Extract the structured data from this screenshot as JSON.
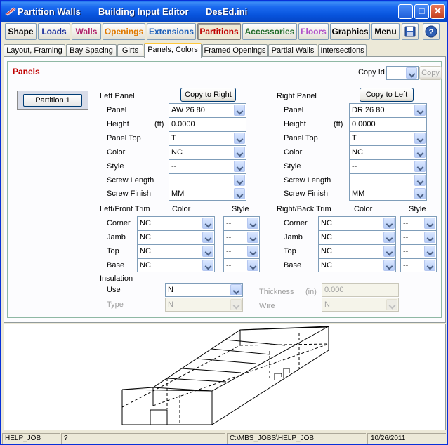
{
  "window": {
    "title_app": "Partition Walls",
    "title_module": "Building Input Editor",
    "title_file": "DesEd.ini",
    "minimize": "_",
    "maximize": "□",
    "close": "✕"
  },
  "toolbar": {
    "buttons": [
      {
        "label": "Shape",
        "color": "#000000"
      },
      {
        "label": "Loads",
        "color": "#1A2E9C"
      },
      {
        "label": "Walls",
        "color": "#B0206A"
      },
      {
        "label": "Openings",
        "color": "#E07A00"
      },
      {
        "label": "Extensions",
        "color": "#1D5FB8"
      },
      {
        "label": "Partitions",
        "color": "#C00000"
      },
      {
        "label": "Accessories",
        "color": "#1E6A28"
      },
      {
        "label": "Floors",
        "color": "#B050C8"
      },
      {
        "label": "Graphics",
        "color": "#000000"
      },
      {
        "label": "Menu",
        "color": "#000000"
      }
    ],
    "icons": [
      "save-icon",
      "help-icon"
    ]
  },
  "subtabs": [
    "Layout, Framing",
    "Bay Spacing",
    "Girts",
    "Panels, Colors",
    "Framed Openings",
    "Partial Walls",
    "Intersections"
  ],
  "panels": {
    "title": "Panels",
    "copy_id_label": "Copy Id",
    "copy_id_value": "",
    "copy_button": "Copy",
    "partition_button": "Partition 1",
    "left": {
      "header": "Left Panel",
      "copy_button": "Copy to Right",
      "panel_label": "Panel",
      "panel_value": "AW 26 80",
      "height_label": "Height",
      "height_unit": "(ft)",
      "height_value": "0.0000",
      "top_label": "Panel Top",
      "top_value": "T",
      "color_label": "Color",
      "color_value": "NC",
      "style_label": "Style",
      "style_value": "--",
      "screw_length_label": "Screw Length",
      "screw_length_value": "",
      "screw_finish_label": "Screw Finish",
      "screw_finish_value": "MM"
    },
    "right": {
      "header": "Right Panel",
      "copy_button": "Copy to Left",
      "panel_label": "Panel",
      "panel_value": "DR 26 80",
      "height_label": "Height",
      "height_unit": "(ft)",
      "height_value": "0.0000",
      "top_label": "Panel Top",
      "top_value": "T",
      "color_label": "Color",
      "color_value": "NC",
      "style_label": "Style",
      "style_value": "--",
      "screw_length_label": "Screw Length",
      "screw_length_value": "",
      "screw_finish_label": "Screw Finish",
      "screw_finish_value": "MM"
    },
    "left_trim": {
      "header": "Left/Front Trim",
      "color_header": "Color",
      "style_header": "Style",
      "rows": [
        {
          "label": "Corner",
          "color": "NC",
          "style": "--"
        },
        {
          "label": "Jamb",
          "color": "NC",
          "style": "--"
        },
        {
          "label": "Top",
          "color": "NC",
          "style": "--"
        },
        {
          "label": "Base",
          "color": "NC",
          "style": "--"
        }
      ]
    },
    "right_trim": {
      "header": "Right/Back Trim",
      "color_header": "Color",
      "style_header": "Style",
      "rows": [
        {
          "label": "Corner",
          "color": "NC",
          "style": "--"
        },
        {
          "label": "Jamb",
          "color": "NC",
          "style": "--"
        },
        {
          "label": "Top",
          "color": "NC",
          "style": "--"
        },
        {
          "label": "Base",
          "color": "NC",
          "style": "--"
        }
      ]
    },
    "insulation": {
      "header": "Insulation",
      "use_label": "Use",
      "use_value": "N",
      "type_label": "Type",
      "type_value": "N",
      "thickness_label": "Thickness",
      "thickness_unit": "(in)",
      "thickness_value": "0.000",
      "wire_label": "Wire",
      "wire_value": "N"
    }
  },
  "statusbar": {
    "job": "HELP_JOB",
    "flag": "?",
    "path": "C:\\MBS_JOBS\\HELP_JOB",
    "date": "10/26/2011"
  }
}
